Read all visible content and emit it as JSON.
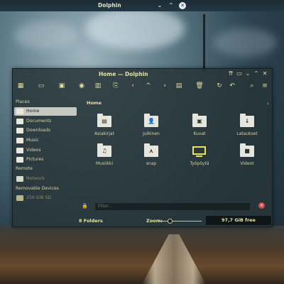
{
  "top_panel": {
    "title": "Dolphin",
    "controls": {
      "minimize": "⌄",
      "maximize": "⌃",
      "close": "✕"
    }
  },
  "window": {
    "title": "Home — Dolphin",
    "controls": {
      "keep_above": "⇈",
      "shade": "▭",
      "minimize": "⌄",
      "maximize": "⌃",
      "close": "✕"
    }
  },
  "toolbar": {
    "icons": [
      "view-icons-icon",
      "view-compact-icon",
      "view-details-icon",
      "preview-icon",
      "split-view-icon",
      "copy-icon",
      "back-icon",
      "up-icon",
      "forward-icon",
      "properties-icon",
      "trash-icon",
      "refresh-icon",
      "undo-icon",
      "search-icon",
      "menu-icon"
    ]
  },
  "sidebar": {
    "places_title": "Places",
    "places": [
      {
        "label": "Home",
        "active": true
      },
      {
        "label": "Documents"
      },
      {
        "label": "Downloads"
      },
      {
        "label": "Music"
      },
      {
        "label": "Videos"
      },
      {
        "label": "Pictures"
      }
    ],
    "remote_title": "Remote",
    "remote": [
      {
        "label": "Network"
      }
    ],
    "devices_title": "Removable Devices",
    "devices": [
      {
        "label": "256 GiB SD"
      }
    ]
  },
  "breadcrumb": "Home",
  "items": [
    {
      "label": "Asiakirjat",
      "icon": "document-folder-icon",
      "sym": "▤"
    },
    {
      "label": "Julkinen",
      "icon": "public-folder-icon",
      "sym": "👤"
    },
    {
      "label": "Kuvat",
      "icon": "pictures-folder-icon",
      "sym": "▣"
    },
    {
      "label": "Lataukset",
      "icon": "downloads-folder-icon",
      "sym": "↓"
    },
    {
      "label": "Musiikki",
      "icon": "music-folder-icon",
      "sym": "♫"
    },
    {
      "label": "snap",
      "icon": "snap-folder-icon",
      "sym": "⋏"
    },
    {
      "label": "Työpöytä",
      "icon": "desktop-icon",
      "sym": ""
    },
    {
      "label": "Videot",
      "icon": "videos-folder-icon",
      "sym": "■"
    }
  ],
  "filter": {
    "placeholder": "Filter..."
  },
  "status": {
    "folders": "8 Folders",
    "zoom_label": "Zoom:",
    "zoom_level": 0.2,
    "free_space": "97,7 GiB free"
  },
  "colors": {
    "accent": "#e6e1a6",
    "monitor": "#e7e35a",
    "clear": "#d04b4b"
  }
}
